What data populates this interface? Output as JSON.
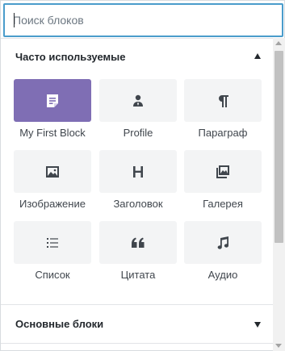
{
  "search": {
    "placeholder": "Поиск блоков",
    "value": ""
  },
  "sections": [
    {
      "title": "Часто используемые",
      "expanded": true,
      "blocks": [
        {
          "label": "My First Block",
          "icon": "document-icon",
          "selected": true
        },
        {
          "label": "Profile",
          "icon": "person-icon",
          "selected": false
        },
        {
          "label": "Параграф",
          "icon": "paragraph-icon",
          "selected": false
        },
        {
          "label": "Изображение",
          "icon": "image-icon",
          "selected": false
        },
        {
          "label": "Заголовок",
          "icon": "heading-icon",
          "selected": false
        },
        {
          "label": "Галерея",
          "icon": "gallery-icon",
          "selected": false
        },
        {
          "label": "Список",
          "icon": "list-icon",
          "selected": false
        },
        {
          "label": "Цитата",
          "icon": "quote-icon",
          "selected": false
        },
        {
          "label": "Аудио",
          "icon": "audio-icon",
          "selected": false
        }
      ]
    },
    {
      "title": "Основные блоки",
      "expanded": false
    }
  ],
  "colors": {
    "accent": "#7f6eb4",
    "focus_border": "#4a9ccb",
    "tile_bg": "#f3f4f5",
    "icon": "#40464d"
  }
}
